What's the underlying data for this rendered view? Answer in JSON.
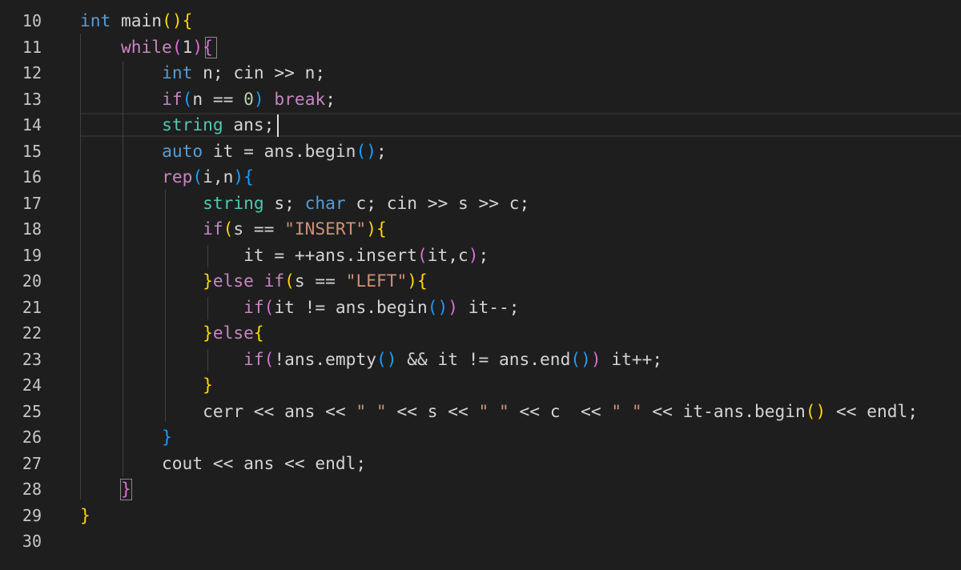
{
  "editor": {
    "language": "cpp",
    "theme_colors": {
      "background": "#1e1e1e",
      "line_number": "#c6c6c6",
      "keyword": "#569cd6",
      "control": "#c586c0",
      "type": "#4ec9b0",
      "string": "#ce9178",
      "number": "#b5cea8",
      "text": "#d4d4d4",
      "bracket_level_1": "#ffd700",
      "bracket_level_2": "#da70d6",
      "bracket_level_3": "#179fff"
    },
    "current_line": 14,
    "lines": [
      {
        "number": "10",
        "tokens": [
          [
            "t-kw",
            "int"
          ],
          [
            "t-var",
            " main"
          ],
          [
            "t-br1",
            "()"
          ],
          [
            "t-br1",
            "{"
          ]
        ]
      },
      {
        "number": "11",
        "tokens": [
          [
            "t-var",
            "    "
          ],
          [
            "t-ctl",
            "while"
          ],
          [
            "t-br2",
            "("
          ],
          [
            "t-var",
            "1"
          ],
          [
            "t-br2",
            ")"
          ],
          [
            "t-br2",
            "{"
          ]
        ]
      },
      {
        "number": "12",
        "tokens": [
          [
            "t-var",
            "        "
          ],
          [
            "t-kw",
            "int"
          ],
          [
            "t-var",
            " n; cin >> n;"
          ]
        ]
      },
      {
        "number": "13",
        "tokens": [
          [
            "t-var",
            "        "
          ],
          [
            "t-ctl",
            "if"
          ],
          [
            "t-br3",
            "("
          ],
          [
            "t-var",
            "n == "
          ],
          [
            "t-num",
            "0"
          ],
          [
            "t-br3",
            ")"
          ],
          [
            "t-var",
            " "
          ],
          [
            "t-ctl",
            "break"
          ],
          [
            "t-var",
            ";"
          ]
        ]
      },
      {
        "number": "14",
        "tokens": [
          [
            "t-var",
            "        "
          ],
          [
            "t-type",
            "string"
          ],
          [
            "t-var",
            " ans;"
          ]
        ]
      },
      {
        "number": "15",
        "tokens": [
          [
            "t-var",
            "        "
          ],
          [
            "t-kw",
            "auto"
          ],
          [
            "t-var",
            " it = ans.begin"
          ],
          [
            "t-br3",
            "()"
          ],
          [
            "t-var",
            ";"
          ]
        ]
      },
      {
        "number": "16",
        "tokens": [
          [
            "t-var",
            "        "
          ],
          [
            "t-ctl",
            "rep"
          ],
          [
            "t-br3",
            "("
          ],
          [
            "t-var",
            "i,n"
          ],
          [
            "t-br3",
            ")"
          ],
          [
            "t-br3",
            "{"
          ]
        ]
      },
      {
        "number": "17",
        "tokens": [
          [
            "t-var",
            "            "
          ],
          [
            "t-type",
            "string"
          ],
          [
            "t-var",
            " s; "
          ],
          [
            "t-kw",
            "char"
          ],
          [
            "t-var",
            " c; cin >> s >> c;"
          ]
        ]
      },
      {
        "number": "18",
        "tokens": [
          [
            "t-var",
            "            "
          ],
          [
            "t-ctl",
            "if"
          ],
          [
            "t-br1",
            "("
          ],
          [
            "t-var",
            "s == "
          ],
          [
            "t-str",
            "\"INSERT\""
          ],
          [
            "t-br1",
            ")"
          ],
          [
            "t-br1",
            "{"
          ]
        ]
      },
      {
        "number": "19",
        "tokens": [
          [
            "t-var",
            "                it = ++ans.insert"
          ],
          [
            "t-br2",
            "("
          ],
          [
            "t-var",
            "it,c"
          ],
          [
            "t-br2",
            ")"
          ],
          [
            "t-var",
            ";"
          ]
        ]
      },
      {
        "number": "20",
        "tokens": [
          [
            "t-var",
            "            "
          ],
          [
            "t-br1",
            "}"
          ],
          [
            "t-ctl",
            "else if"
          ],
          [
            "t-br1",
            "("
          ],
          [
            "t-var",
            "s == "
          ],
          [
            "t-str",
            "\"LEFT\""
          ],
          [
            "t-br1",
            ")"
          ],
          [
            "t-br1",
            "{"
          ]
        ]
      },
      {
        "number": "21",
        "tokens": [
          [
            "t-var",
            "                "
          ],
          [
            "t-ctl",
            "if"
          ],
          [
            "t-br2",
            "("
          ],
          [
            "t-var",
            "it != ans.begin"
          ],
          [
            "t-br3",
            "()"
          ],
          [
            "t-br2",
            ")"
          ],
          [
            "t-var",
            " it--;"
          ]
        ]
      },
      {
        "number": "22",
        "tokens": [
          [
            "t-var",
            "            "
          ],
          [
            "t-br1",
            "}"
          ],
          [
            "t-ctl",
            "else"
          ],
          [
            "t-br1",
            "{"
          ]
        ]
      },
      {
        "number": "23",
        "tokens": [
          [
            "t-var",
            "                "
          ],
          [
            "t-ctl",
            "if"
          ],
          [
            "t-br2",
            "("
          ],
          [
            "t-var",
            "!ans.empty"
          ],
          [
            "t-br3",
            "()"
          ],
          [
            "t-var",
            " && it != ans.end"
          ],
          [
            "t-br3",
            "()"
          ],
          [
            "t-br2",
            ")"
          ],
          [
            "t-var",
            " it++;"
          ]
        ]
      },
      {
        "number": "24",
        "tokens": [
          [
            "t-var",
            "            "
          ],
          [
            "t-br1",
            "}"
          ]
        ]
      },
      {
        "number": "25",
        "tokens": [
          [
            "t-var",
            "            cerr << ans << "
          ],
          [
            "t-str",
            "\" \""
          ],
          [
            "t-var",
            " << s << "
          ],
          [
            "t-str",
            "\" \""
          ],
          [
            "t-var",
            " << c  << "
          ],
          [
            "t-str",
            "\" \""
          ],
          [
            "t-var",
            " << it-ans.begin"
          ],
          [
            "t-br1",
            "()"
          ],
          [
            "t-var",
            " << endl;"
          ]
        ]
      },
      {
        "number": "26",
        "tokens": [
          [
            "t-var",
            "        "
          ],
          [
            "t-br3",
            "}"
          ]
        ]
      },
      {
        "number": "27",
        "tokens": [
          [
            "t-var",
            "        cout << ans << endl;"
          ]
        ]
      },
      {
        "number": "28",
        "tokens": [
          [
            "t-var",
            "    "
          ],
          [
            "t-br2",
            "}"
          ]
        ]
      },
      {
        "number": "29",
        "tokens": [
          [
            "t-br1",
            "}"
          ]
        ]
      },
      {
        "number": "30",
        "tokens": []
      }
    ]
  }
}
